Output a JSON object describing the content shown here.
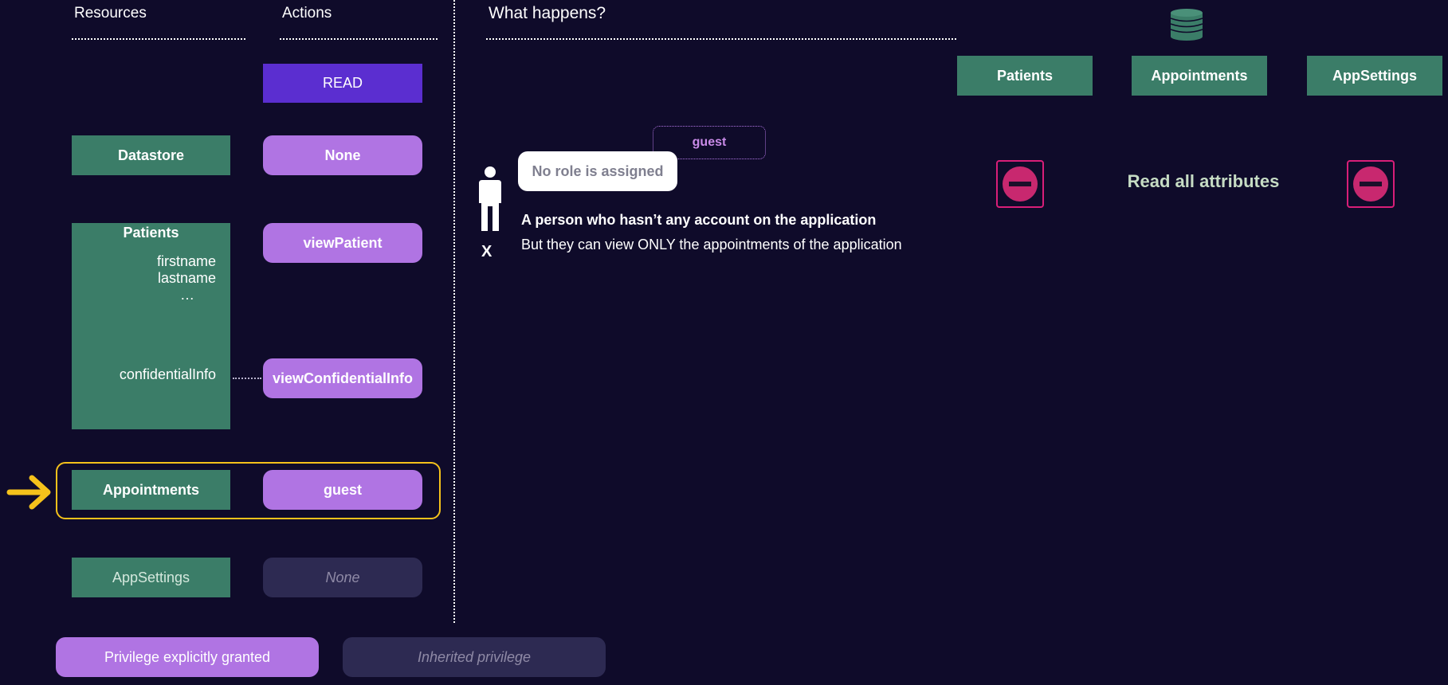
{
  "headers": {
    "resources": "Resources",
    "actions": "Actions",
    "what": "What happens?"
  },
  "read_label": "READ",
  "rows": {
    "datastore": {
      "resource": "Datastore",
      "action": "None"
    },
    "patients": {
      "resource": "Patients",
      "attr_firstname": "firstname",
      "attr_lastname": "lastname",
      "attr_more": "…",
      "attr_confidential": "confidentialInfo",
      "action_view": "viewPatient",
      "action_confidential": "viewConfidentialInfo"
    },
    "appointments": {
      "resource": "Appointments",
      "action": "guest"
    },
    "appsettings": {
      "resource": "AppSettings",
      "action": "None"
    }
  },
  "legend": {
    "granted": "Privilege explicitly granted",
    "inherited": "Inherited privilege"
  },
  "scenario": {
    "role_tag": "guest",
    "bubble": "No role is assigned",
    "person_mark": "X",
    "title": "A person who hasn’t any account on the application",
    "desc": "But they can view ONLY the appointments of the application"
  },
  "columns": [
    {
      "name": "Patients",
      "result": "denied"
    },
    {
      "name": "Appointments",
      "result": "Read all attributes"
    },
    {
      "name": "AppSettings",
      "result": "denied"
    }
  ],
  "icons": {
    "database": "database-icon",
    "person": "person-icon",
    "arrow": "arrow-right-icon",
    "deny": "no-entry-icon"
  },
  "colors": {
    "background": "#0f0b2a",
    "resource": "#3b7d68",
    "granted": "#b074e3",
    "inherited": "#2d2a52",
    "read": "#5b2ed0",
    "highlight": "#f5c21b",
    "deny": "#c8286f",
    "result_text": "#c6dcc4"
  }
}
